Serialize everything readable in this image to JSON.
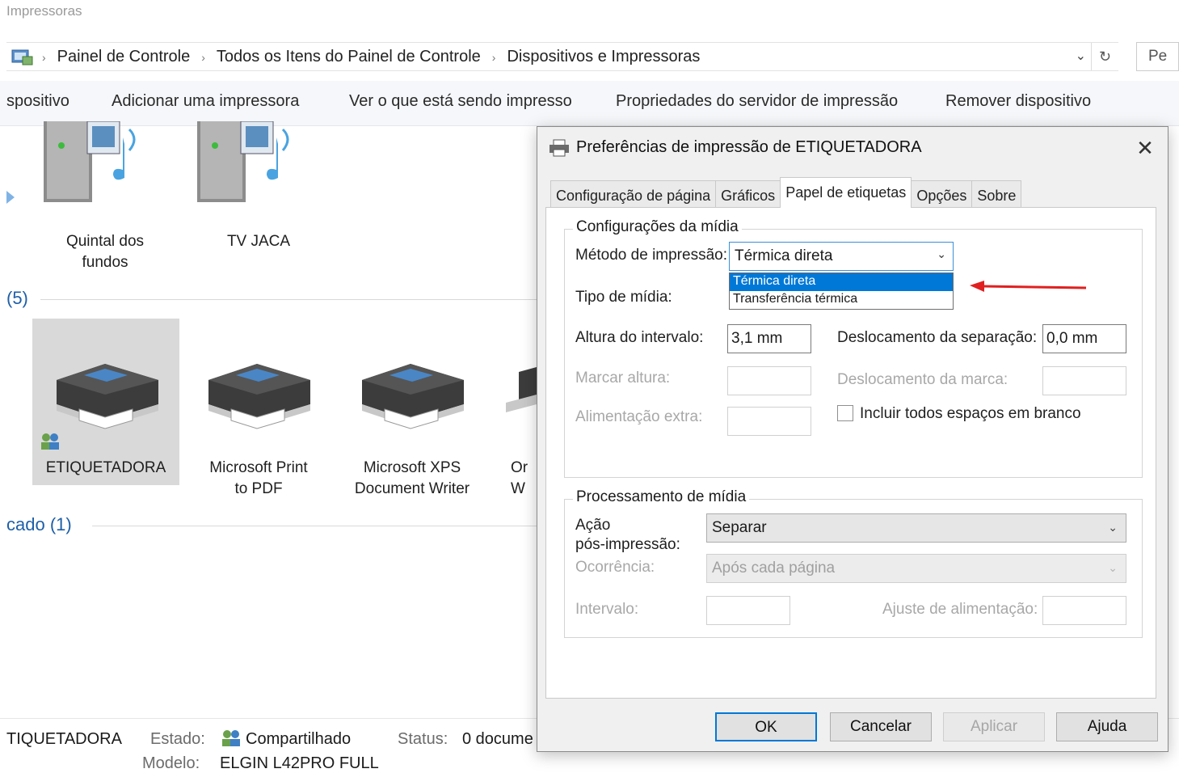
{
  "window": {
    "title": "Impressoras"
  },
  "address_bar": {
    "crumbs": [
      "Painel de Controle",
      "Todos os Itens do Painel de Controle",
      "Dispositivos e Impressoras"
    ],
    "search_placeholder": "Pe"
  },
  "command_bar": {
    "items": [
      "spositivo",
      "Adicionar uma impressora",
      "Ver o que está sendo impresso",
      "Propriedades do servidor de impressão",
      "Remover dispositivo"
    ]
  },
  "media_devices": [
    {
      "label_line1": "Quintal dos",
      "label_line2": "fundos"
    },
    {
      "label_line1": "TV JACA",
      "label_line2": ""
    }
  ],
  "printers_section": {
    "label": "(5)"
  },
  "printers": [
    {
      "label_line1": "ETIQUETADORA",
      "label_line2": ""
    },
    {
      "label_line1": "Microsoft Print",
      "label_line2": "to PDF"
    },
    {
      "label_line1": "Microsoft XPS",
      "label_line2": "Document Writer"
    },
    {
      "label_line1": "Or",
      "label_line2": "W"
    }
  ],
  "unspecified_section": {
    "label": "cado (1)"
  },
  "status_bar": {
    "device": "TIQUETADORA",
    "state_label": "Estado:",
    "state_value": "Compartilhado",
    "status_label": "Status:",
    "status_value": "0 docume",
    "model_label": "Modelo:",
    "model_value": "ELGIN L42PRO FULL"
  },
  "dialog": {
    "title": "Preferências de impressão de ETIQUETADORA",
    "tabs": [
      "Configuração de página",
      "Gráficos",
      "Papel de etiquetas",
      "Opções",
      "Sobre"
    ],
    "active_tab": "Papel de etiquetas",
    "media_group": {
      "title": "Configurações da mídia",
      "method_label": "Método de impressão:",
      "method_value": "Térmica direta",
      "method_options": [
        "Térmica direta",
        "Transferência térmica"
      ],
      "media_type_label": "Tipo de mídia:",
      "gap_height_label": "Altura do intervalo:",
      "gap_height_value": "3,1 mm",
      "sep_offset_label": "Deslocamento da separação:",
      "sep_offset_value": "0,0 mm",
      "mark_height_label": "Marcar altura:",
      "mark_offset_label": "Deslocamento da marca:",
      "extra_feed_label": "Alimentação extra:",
      "include_blank_label": "Incluir todos espaços em branco"
    },
    "processing_group": {
      "title": "Processamento de mídia",
      "post_action_label_1": "Ação",
      "post_action_label_2": "pós-impressão:",
      "post_action_value": "Separar",
      "occurrence_label": "Ocorrência:",
      "occurrence_value": "Após cada página",
      "interval_label": "Intervalo:",
      "feed_adjust_label": "Ajuste de alimentação:"
    },
    "buttons": {
      "ok": "OK",
      "cancel": "Cancelar",
      "apply": "Aplicar",
      "help": "Ajuda"
    }
  },
  "colors": {
    "accent": "#0078d7",
    "arrow": "#e02020",
    "section_text": "#1e5fa8"
  }
}
